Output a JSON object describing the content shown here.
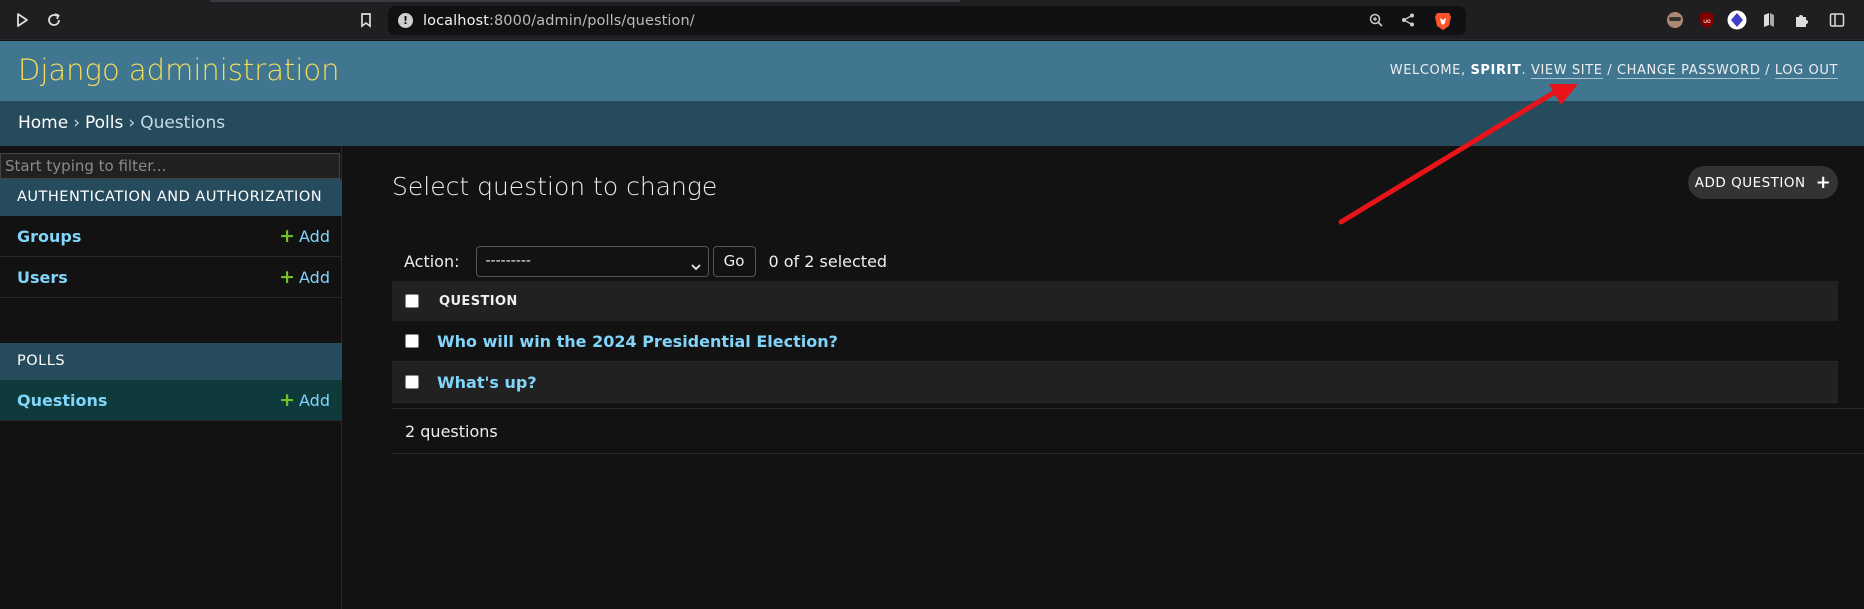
{
  "browser": {
    "url_host": "localhost",
    "url_path": ":8000/admin/polls/question/"
  },
  "header": {
    "brand": "Django administration",
    "welcome": "Welcome,",
    "username": "Spirit",
    "view_site": "View site",
    "change_password": "Change password",
    "log_out": "Log out"
  },
  "breadcrumbs": {
    "home": "Home",
    "app": "Polls",
    "current": "Questions",
    "sep": "›"
  },
  "sidebar": {
    "filter_placeholder": "Start typing to filter...",
    "modules": [
      {
        "name": "Authentication and Authorization",
        "items": [
          {
            "label": "Groups",
            "add": "Add"
          },
          {
            "label": "Users",
            "add": "Add"
          }
        ]
      },
      {
        "name": "Polls",
        "items": [
          {
            "label": "Questions",
            "add": "Add"
          }
        ]
      }
    ]
  },
  "content": {
    "title": "Select question to change",
    "add_button": "Add question",
    "action_label": "Action:",
    "action_selected": "---------",
    "go": "Go",
    "selected_count": "0 of 2 selected",
    "column_header": "Question",
    "rows": [
      "Who will win the 2024 Presidential Election?",
      "What's up?"
    ],
    "paginator": "2 questions"
  },
  "colors": {
    "header_bg": "#417690",
    "brand": "#f5dd5d",
    "breadcrumbs_bg": "#264b5d",
    "link": "#81d4fa",
    "add_plus": "#70bf2b",
    "annotation_arrow": "#e8141a"
  }
}
